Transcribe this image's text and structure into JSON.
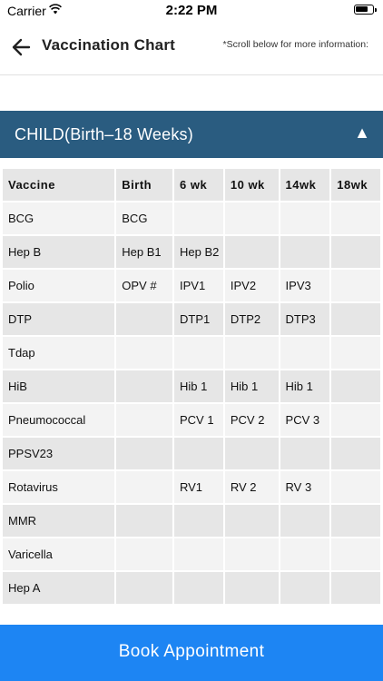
{
  "status_bar": {
    "carrier": "Carrier",
    "time": "2:22 PM"
  },
  "nav": {
    "title": "Vaccination Chart",
    "note": "*Scroll below for more information:"
  },
  "section": {
    "title": "CHILD(Birth–18 Weeks)",
    "toggle_icon": "▲"
  },
  "table": {
    "headers": [
      "Vaccine",
      "Birth",
      "6 wk",
      "10 wk",
      "14wk",
      "18wk"
    ],
    "rows": [
      [
        "BCG",
        "BCG",
        "",
        "",
        "",
        ""
      ],
      [
        "Hep B",
        "Hep B1",
        "Hep B2",
        "",
        "",
        ""
      ],
      [
        "Polio",
        "OPV #",
        "IPV1",
        "IPV2",
        "IPV3",
        ""
      ],
      [
        "DTP",
        "",
        "DTP1",
        "DTP2",
        "DTP3",
        ""
      ],
      [
        "Tdap",
        "",
        "",
        "",
        "",
        ""
      ],
      [
        "HiB",
        "",
        "Hib 1",
        "Hib 1",
        "Hib 1",
        ""
      ],
      [
        "Pneumococcal",
        "",
        "PCV 1",
        "PCV 2",
        "PCV 3",
        ""
      ],
      [
        "PPSV23",
        "",
        "",
        "",
        "",
        ""
      ],
      [
        "Rotavirus",
        "",
        "RV1",
        "RV 2",
        "RV 3",
        ""
      ],
      [
        "MMR",
        "",
        "",
        "",
        "",
        ""
      ],
      [
        "Varicella",
        "",
        "",
        "",
        "",
        ""
      ],
      [
        "Hep A",
        "",
        "",
        "",
        "",
        ""
      ]
    ]
  },
  "footer": {
    "button_label": "Book Appointment"
  },
  "colors": {
    "section_header": "#2a5c80",
    "button": "#1d85f3"
  }
}
